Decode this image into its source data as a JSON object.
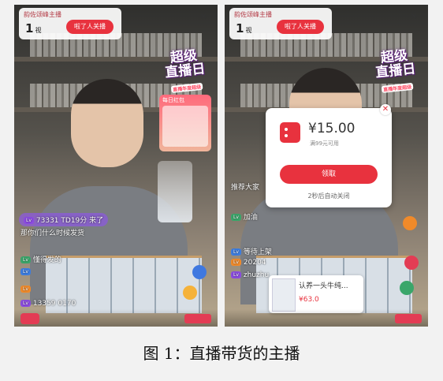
{
  "left": {
    "top_pill": {
      "title": "韵佐颂峰主播",
      "count": "1",
      "count_unit": "视",
      "button": "啦了人关播"
    },
    "badge": {
      "line1": "超级",
      "line2": "直播日",
      "tag": "直播年度超级"
    },
    "promo_label": "每日红包",
    "comments": [
      {
        "level": "",
        "text": "73331 TD19分  来了"
      },
      {
        "level": "",
        "text": "那你们什么时候发货"
      },
      {
        "level": "",
        "text": "懂得发的"
      },
      {
        "level": "",
        "text": "13359 0170"
      }
    ]
  },
  "right": {
    "top_pill": {
      "title": "韵佐颂峰主播",
      "count": "1",
      "count_unit": "视",
      "button": "啦了人关播"
    },
    "badge": {
      "line1": "超级",
      "line2": "直播日",
      "tag": "直播年度超级"
    },
    "popup": {
      "price": "¥15.00",
      "sub": "满99元可用",
      "claim": "领取",
      "timer": "2秒后自动关闭"
    },
    "comments": [
      {
        "text": "推荐大家"
      },
      {
        "text": "加油 "
      },
      {
        "text": "等待上架 "
      },
      {
        "text": "20204 "
      },
      {
        "text": "zhuzhu "
      }
    ],
    "product": {
      "name": "认养一头牛纯...",
      "price": "¥63.0"
    }
  },
  "caption": "图 1：直播带货的主播"
}
